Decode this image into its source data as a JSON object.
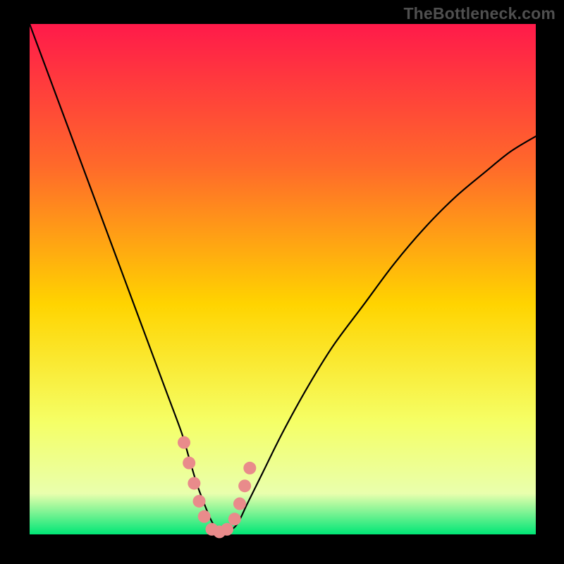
{
  "watermark": "TheBottleneck.com",
  "colors": {
    "frame": "#000000",
    "grad_top": "#ff1a4a",
    "grad_q1": "#ff6a2a",
    "grad_mid": "#ffd400",
    "grad_q3": "#f5ff66",
    "grad_low": "#e9ffad",
    "grad_bottom": "#00e676",
    "curve": "#000000",
    "marker_fill": "#e98b8b",
    "marker_stroke": "#e98b8b"
  },
  "chart_data": {
    "type": "line",
    "title": "",
    "xlabel": "",
    "ylabel": "",
    "xlim": [
      0,
      100
    ],
    "ylim": [
      0,
      100
    ],
    "series": [
      {
        "name": "bottleneck-curve",
        "x": [
          0,
          3,
          6,
          9,
          12,
          15,
          18,
          21,
          24,
          27,
          30,
          31.5,
          33,
          34.5,
          36,
          37.5,
          39,
          41,
          43,
          46,
          50,
          55,
          60,
          66,
          72,
          78,
          84,
          90,
          95,
          100
        ],
        "y": [
          100,
          92,
          84,
          76,
          68,
          60,
          52,
          44,
          36,
          28,
          20,
          15,
          10,
          6,
          2.5,
          0.4,
          0.4,
          2,
          6,
          12,
          20,
          29,
          37,
          45,
          53,
          60,
          66,
          71,
          75,
          78
        ]
      }
    ],
    "markers": {
      "name": "optimal-zone",
      "x": [
        30.5,
        31.5,
        32.5,
        33.5,
        34.5,
        36,
        37.5,
        39,
        40.5,
        41.5,
        42.5,
        43.5
      ],
      "y": [
        18,
        14,
        10,
        6.5,
        3.5,
        1,
        0.5,
        1,
        3,
        6,
        9.5,
        13
      ]
    },
    "annotations": []
  }
}
